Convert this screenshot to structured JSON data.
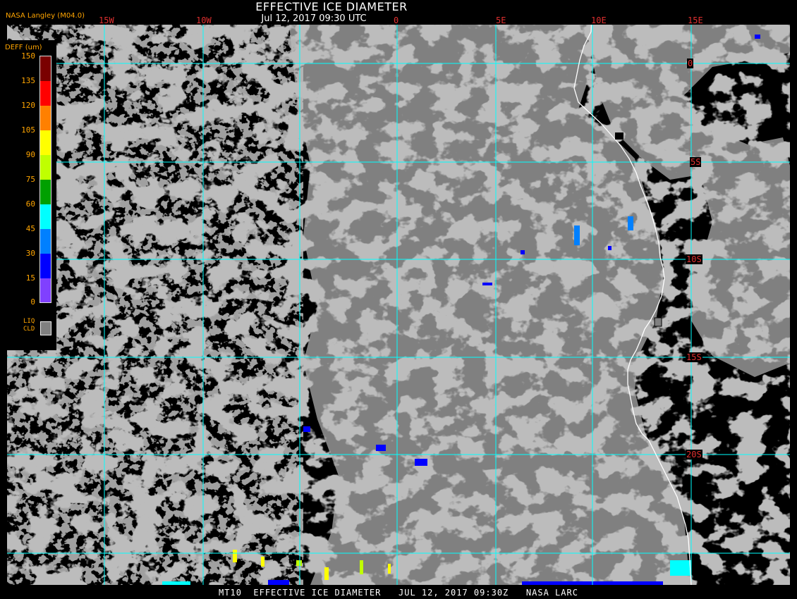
{
  "header": {
    "title": "EFFECTIVE ICE DIAMETER",
    "subtitle": "Jul 12, 2017 09:30 UTC",
    "credit": "NASA Langley (M04.0)"
  },
  "legend": {
    "title": "DEFF (um)",
    "ticks": [
      "150",
      "135",
      "120",
      "105",
      "90",
      "75",
      "60",
      "45",
      "30",
      "15",
      "0"
    ],
    "colors": [
      "#7a0000",
      "#c00000",
      "#ff0000",
      "#ff8000",
      "#ffff00",
      "#c0ff00",
      "#00a000",
      "#00ffff",
      "#0080ff",
      "#0000ff",
      "#8040ff"
    ],
    "liquid_label_line1": "LIQ",
    "liquid_label_line2": "CLD",
    "liquid_color": "#808080"
  },
  "map": {
    "longitude_labels": [
      "15W",
      "10W",
      "0",
      "5E",
      "10E",
      "15E"
    ],
    "latitude_labels": [
      "0",
      "5S",
      "10S",
      "15S",
      "20S"
    ],
    "grid_color": "#00ffff",
    "coast_color": "#ffffff",
    "cloud_color": "#808080",
    "clear_color": "#000000"
  },
  "footer": {
    "text": "MT10  EFFECTIVE ICE DIAMETER   JUL 12, 2017 09:30Z   NASA LARC"
  }
}
